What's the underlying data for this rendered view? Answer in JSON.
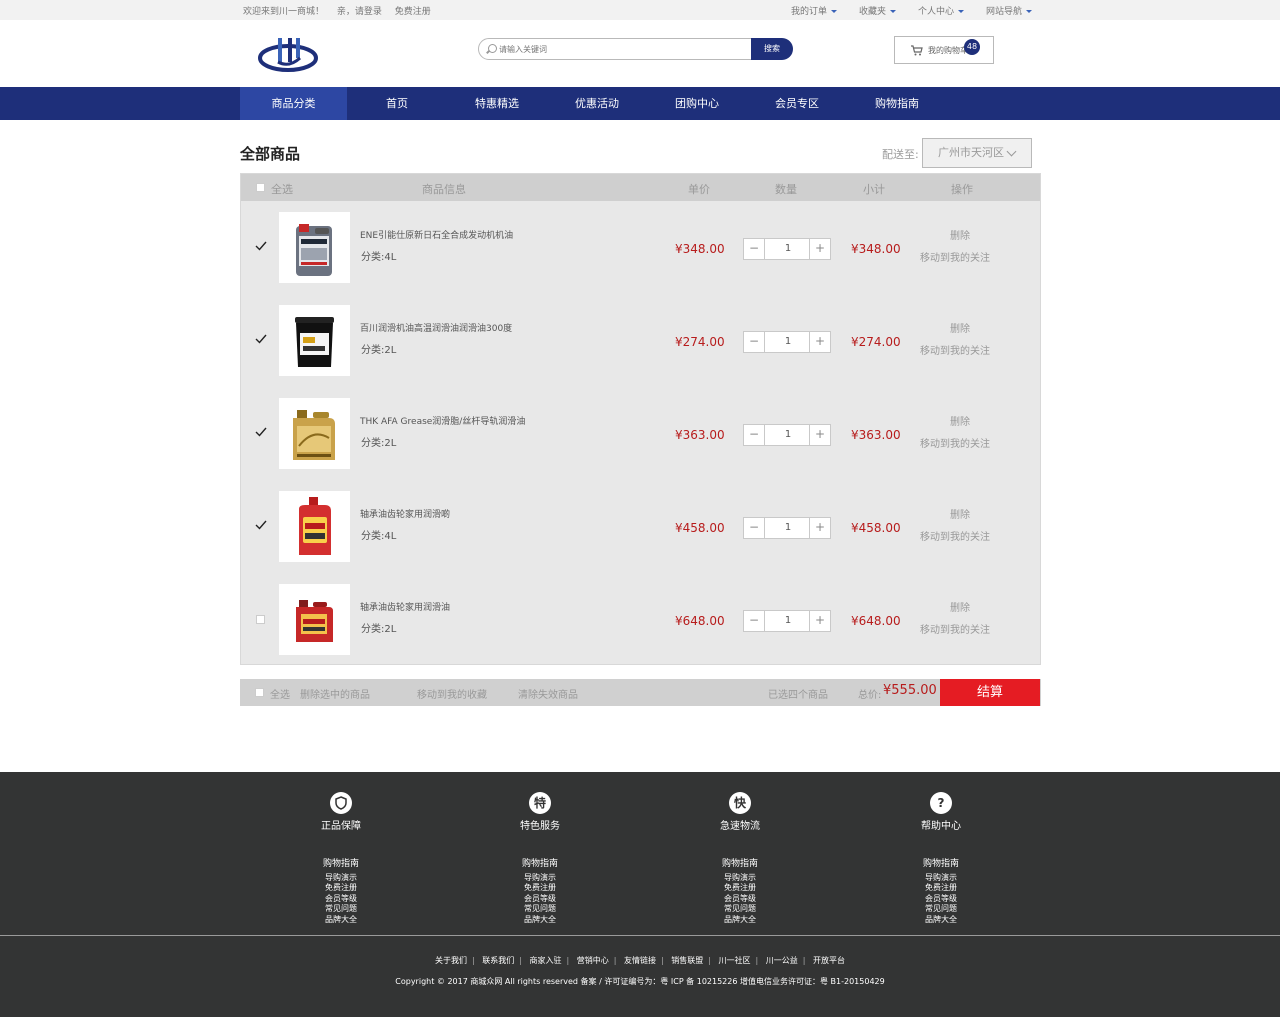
{
  "topbar": {
    "welcome": "欢迎来到川一商城！",
    "login": "亲，请登录",
    "register": "免费注册",
    "links": [
      "我的订单",
      "收藏夹",
      "个人中心",
      "网站导航"
    ]
  },
  "search": {
    "placeholder": "请输入关键词",
    "button": "搜索"
  },
  "cart": {
    "label": "我的购物车",
    "count": "48"
  },
  "nav": {
    "items": [
      "商品分类",
      "首页",
      "特惠精选",
      "优惠活动",
      "团购中心",
      "会员专区",
      "购物指南"
    ]
  },
  "main": {
    "title": "全部商品",
    "ship_label": "配送至:",
    "ship_value": "广州市天河区"
  },
  "table": {
    "headers": {
      "select_all": "全选",
      "info": "商品信息",
      "price": "单价",
      "qty": "数量",
      "subtotal": "小计",
      "action": "操作"
    },
    "rows": [
      {
        "name": "ENE引能仕原新日石全合成发动机机油",
        "spec": "分类:4L",
        "price": "¥348.00",
        "qty": "1",
        "subtotal": "¥348.00",
        "checked": true,
        "delete": "删除",
        "move": "移动到我的关注"
      },
      {
        "name": "百川润滑机油高温润滑油润滑油300度",
        "spec": "分类:2L",
        "price": "¥274.00",
        "qty": "1",
        "subtotal": "¥274.00",
        "checked": true,
        "delete": "删除",
        "move": "移动到我的关注"
      },
      {
        "name": "THK AFA Grease润滑脂/丝杆导轨润滑油",
        "spec": "分类:2L",
        "price": "¥363.00",
        "qty": "1",
        "subtotal": "¥363.00",
        "checked": true,
        "delete": "删除",
        "move": "移动到我的关注"
      },
      {
        "name": "轴承油齿轮家用润滑啲",
        "spec": "分类:4L",
        "price": "¥458.00",
        "qty": "1",
        "subtotal": "¥458.00",
        "checked": true,
        "delete": "删除",
        "move": "移动到我的关注"
      },
      {
        "name": "轴承油齿轮家用润滑油",
        "spec": "分类:2L",
        "price": "¥648.00",
        "qty": "1",
        "subtotal": "¥648.00",
        "checked": false,
        "delete": "删除",
        "move": "移动到我的关注"
      }
    ]
  },
  "footer_bar": {
    "select_all": "全选",
    "delete_selected": "删除选中的商品",
    "move_fav": "移动到我的收藏",
    "clear_invalid": "清除失效商品",
    "selected": "已选四个商品",
    "total_label": "总价:",
    "total": "¥555.00",
    "checkout": "结算"
  },
  "site_footer": {
    "columns": [
      {
        "icon": "shield",
        "title": "正品保障",
        "links": [
          "购物指南",
          "导购演示",
          "免费注册",
          "会员等级",
          "常见问题",
          "品牌大全"
        ]
      },
      {
        "icon": "特",
        "title": "特色服务",
        "links": [
          "购物指南",
          "导购演示",
          "免费注册",
          "会员等级",
          "常见问题",
          "品牌大全"
        ]
      },
      {
        "icon": "快",
        "title": "急速物流",
        "links": [
          "购物指南",
          "导购演示",
          "免费注册",
          "会员等级",
          "常见问题",
          "品牌大全"
        ]
      },
      {
        "icon": "?",
        "title": "帮助中心",
        "links": [
          "购物指南",
          "导购演示",
          "免费注册",
          "会员等级",
          "常见问题",
          "品牌大全"
        ]
      }
    ],
    "bottom_links": [
      "关于我们",
      "联系我们",
      "商家入驻",
      "营销中心",
      "友情链接",
      "销售联盟",
      "川一社区",
      "川一公益",
      "开放平台"
    ],
    "copyright": "Copyright © 2017 商城众网 All rights reserved 备案 / 许可证编号为：粤 ICP 备 10215226 增值电信业务许可证：粤 B1-20150429"
  },
  "colors": {
    "brand": "#1e2f7a",
    "price": "#b71c1c",
    "checkout": "#e51c23"
  }
}
